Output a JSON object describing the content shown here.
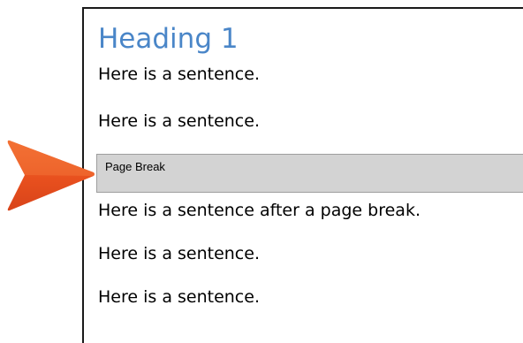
{
  "document": {
    "heading": "Heading 1",
    "paragraphs_before_break": [
      "Here is a sentence.",
      "Here is a sentence."
    ],
    "page_break_label": "Page Break",
    "paragraphs_after_break": [
      "Here is a sentence after a page break.",
      "Here is a sentence.",
      "Here is a sentence."
    ]
  },
  "callout": {
    "icon": "arrow-pointer-icon",
    "color": "#e8501e"
  },
  "colors": {
    "heading": "#4a86c8",
    "page_break_background": "#d3d3d3"
  }
}
